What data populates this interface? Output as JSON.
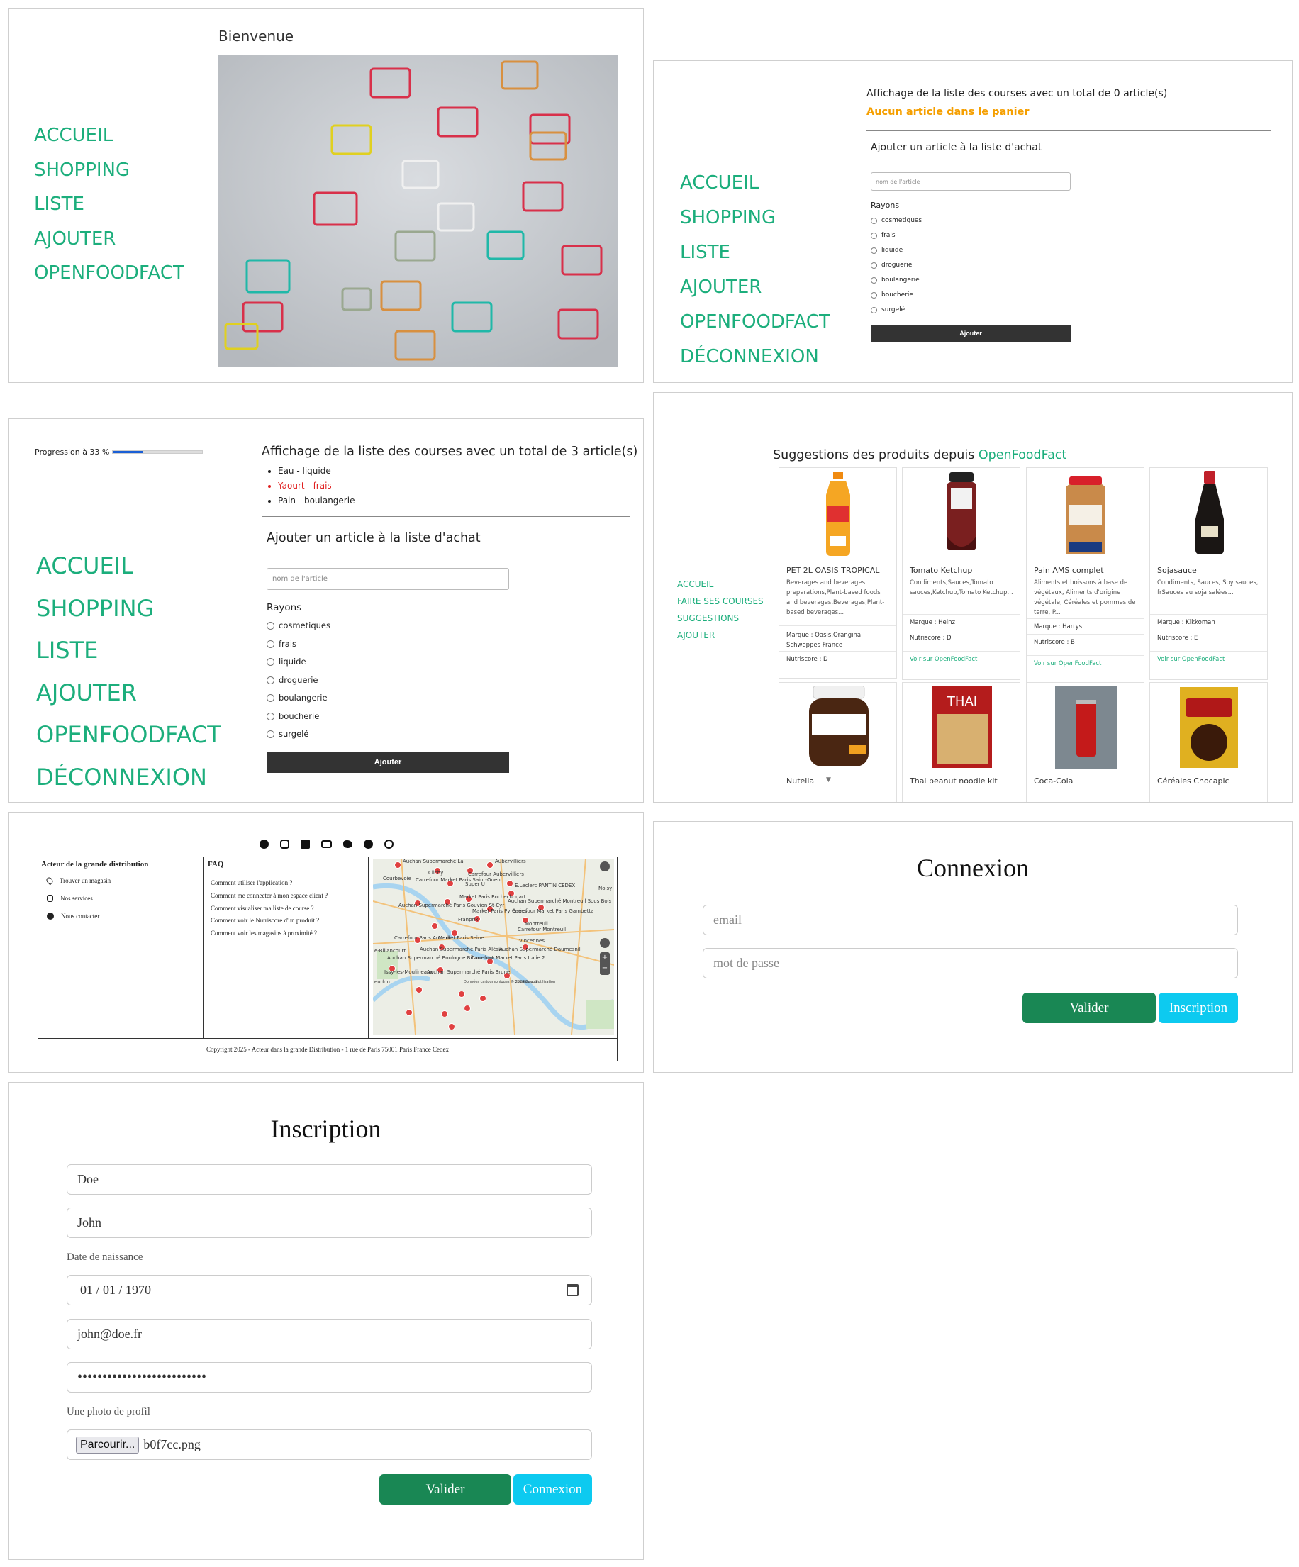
{
  "nav_p1": [
    "ACCUEIL",
    "SHOPPING",
    "LISTE",
    "AJOUTER",
    "OPENFOODFACT"
  ],
  "nav_full": [
    "ACCUEIL",
    "SHOPPING",
    "LISTE",
    "AJOUTER",
    "OPENFOODFACT",
    "DÉCONNEXION"
  ],
  "home": {
    "title": "Bienvenue"
  },
  "empty_list": {
    "heading": "Affichage de la liste des courses avec un total de 0 article(s)",
    "empty_msg": "Aucun article dans le panier"
  },
  "form": {
    "title": "Ajouter un article à la liste d'achat",
    "placeholder": "nom de l'article",
    "rayons_label": "Rayons",
    "rayons": [
      "cosmetiques",
      "frais",
      "liquide",
      "droguerie",
      "boulangerie",
      "boucherie",
      "surgelé"
    ],
    "submit": "Ajouter"
  },
  "list3": {
    "progress_label": "Progression à 33 %",
    "progress_value": 0.33,
    "heading": "Affichage de la liste des courses avec un total de 3 article(s)",
    "items": [
      "Eau - liquide",
      "Yaourt - frais",
      "Pain - boulangerie"
    ],
    "done_color": "#e02020"
  },
  "suggestions": {
    "title_prefix": "Suggestions des produits depuis ",
    "title_brand": "OpenFoodFact",
    "nav": [
      "ACCUEIL",
      "FAIRE SES COURSES",
      "SUGGESTIONS",
      "AJOUTER"
    ],
    "products": [
      {
        "name": "PET 2L OASIS TROPICAL",
        "desc": "Beverages and beverages preparations,Plant-based foods and beverages,Beverages,Plant-based beverages...",
        "brand": "Marque : Oasis,Orangina Schweppes France",
        "nutri": "Nutriscore : D",
        "link": ""
      },
      {
        "name": "Tomato Ketchup",
        "desc": "Condiments,Sauces,Tomato sauces,Ketchup,Tomato Ketchup...",
        "brand": "Marque : Heinz",
        "nutri": "Nutriscore : D",
        "link": "Voir sur OpenFoodFact"
      },
      {
        "name": "Pain AMS complet",
        "desc": "Aliments et boissons à base de végétaux, Aliments d'origine végétale, Céréales et pommes de terre, P...",
        "brand": "Marque : Harrys",
        "nutri": "Nutriscore : B",
        "link": "Voir sur OpenFoodFact"
      },
      {
        "name": "Sojasauce",
        "desc": "Condiments, Sauces, Soy sauces, frSauces au soja salées...",
        "brand": "Marque : Kikkoman",
        "nutri": "Nutriscore : E",
        "link": "Voir sur OpenFoodFact"
      }
    ],
    "products_row2": [
      "Nutella",
      "Thai peanut noodle kit",
      "Coca-Cola",
      "Céréales Chocapic"
    ]
  },
  "footer": {
    "col1_title": "Acteur de la grande distribution",
    "col1_items": [
      "Trouver un magasin",
      "Nos services",
      "Nous contacter"
    ],
    "faq_title": "FAQ",
    "faq_items": [
      "Comment utiliser l'application ?",
      "Comment me connecter à mon espace client ?",
      "Comment visualiser ma liste de course ?",
      "Comment voir le Nutriscore d'un produit ?",
      "Comment voir les magasins à proximité ?"
    ],
    "copyright": "Copyright 2025 - Acteur dans la grande Distribution - 1 rue de Paris 75001 Paris France Cedex",
    "map_labels": [
      "Auchan Supermarché La",
      "Aubervilliers",
      "Carrefour Market Paris Saint-Ouen",
      "Clichy",
      "Carrefour Aubervilliers",
      "Courbevoie",
      "Super U",
      "E.Leclerc PANTIN CEDEX",
      "Noisy",
      "Market Paris Rochechouart",
      "Auchan Supermarché Paris Gouvion St-Cyr",
      "Auchan Supermarché Montreuil Sous Bois",
      "Market Paris Pyrénées",
      "Carrefour Market Paris Gambetta",
      "Franprix",
      "Carrefour Montreuil",
      "Montreuil",
      "Market Paris Seine",
      "Vincennes",
      "Auchan Supermarché Paris Alésia",
      "Carrefour Paris Auteuil",
      "Auchan Supermarché Daumesnil",
      "e-Billancourt",
      "Auchan Supermarché Boulogne Billancourt",
      "Carrefour Market Paris Italie 2",
      "Issy-les-Moulineaux",
      "Auchan Supermarché Paris Brune",
      "eudon",
      "Données cartographiques © 2025 Google",
      "Conditions d'utilisation",
      "14E",
      "13E",
      "12E",
      "15E",
      "17E",
      "11E",
      "20E",
      "18E",
      "19E"
    ]
  },
  "connexion": {
    "title": "Connexion",
    "email_ph": "email",
    "pwd_ph": "mot de passe",
    "submit": "Valider",
    "alt": "Inscription"
  },
  "inscription": {
    "title": "Inscription",
    "nom": "Doe",
    "prenom": "John",
    "dob_label": "Date de naissance",
    "dob": "01 / 01 / 1970",
    "email": "john@doe.fr",
    "pwd": "••••••••••••••••••••••••••",
    "photo_label": "Une photo de profil",
    "browse": "Parcourir...",
    "file": "b0f7cc.png",
    "submit": "Valider",
    "alt": "Connexion"
  },
  "colors": {
    "accent": "#1cae7c",
    "warning": "#f59f00",
    "green_btn": "#198754",
    "cyan_btn": "#0dcaf0"
  }
}
